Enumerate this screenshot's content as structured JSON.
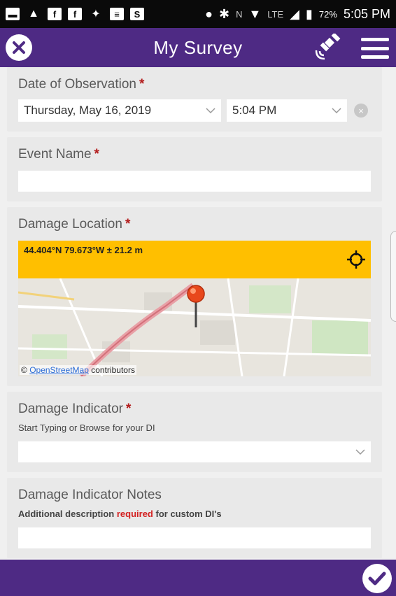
{
  "status_bar": {
    "left_icons": [
      "android-messages-icon",
      "alert-icon",
      "facebook-icon",
      "facebook-icon",
      "twitter-icon",
      "news-icon",
      "s-app-icon"
    ],
    "right_icons": [
      "location-icon",
      "bluetooth-icon",
      "nfc-icon",
      "wifi-icon",
      "lte-icon",
      "signal-icon",
      "battery-icon"
    ],
    "lte_label": "LTE",
    "nfc_label": "N",
    "battery": "72%",
    "time": "5:05 PM"
  },
  "header": {
    "title": "My Survey",
    "color": "#4e2a84"
  },
  "form": {
    "date": {
      "label": "Date of Observation",
      "required_mark": "*",
      "date_value": "Thursday, May 16, 2019",
      "time_value": "5:04 PM",
      "clear_glyph": "×"
    },
    "event_name": {
      "label": "Event Name",
      "required_mark": "*",
      "value": ""
    },
    "damage_location": {
      "label": "Damage Location",
      "required_mark": "*",
      "coordinates": "44.404°N 79.673°W ± 21.2 m",
      "attribution_prefix": "©",
      "attribution_link": "OpenStreetMap",
      "attribution_suffix": "contributors",
      "bar_color": "#ffbf00"
    },
    "damage_indicator": {
      "label": "Damage Indicator",
      "required_mark": "*",
      "hint": "Start Typing or Browse for your DI",
      "value": ""
    },
    "damage_indicator_notes": {
      "label": "Damage Indicator Notes",
      "hint_before": "Additional description",
      "hint_required": "required",
      "hint_after": "for custom DI's"
    }
  }
}
